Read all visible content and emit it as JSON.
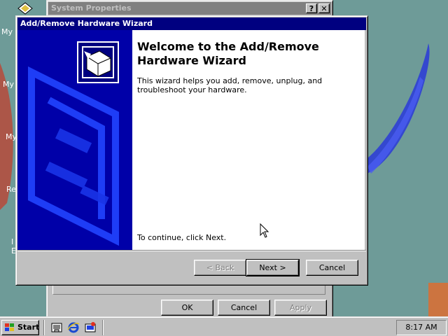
{
  "desktop": {
    "icon_labels": [
      "My D",
      "My",
      "My",
      "Re",
      "I",
      "E"
    ]
  },
  "system_properties": {
    "title": "System Properties",
    "help_glyph": "?",
    "close_glyph": "✕",
    "buttons": {
      "ok": "OK",
      "cancel": "Cancel",
      "apply": "Apply"
    }
  },
  "wizard": {
    "title": "Add/Remove Hardware Wizard",
    "heading": "Welcome to the Add/Remove Hardware Wizard",
    "body": "This wizard helps you add, remove, unplug, and troubleshoot your hardware.",
    "continue_text": "To continue, click Next.",
    "buttons": {
      "back": "< Back",
      "next": "Next >",
      "cancel": "Cancel"
    }
  },
  "taskbar": {
    "start_label": "Start",
    "quick_launch": [
      "show-desktop-icon",
      "internet-explorer-icon",
      "channels-icon"
    ],
    "clock": "8:17 AM"
  },
  "colors": {
    "desktop": "#6e9b98",
    "title_active": "#000080",
    "title_inactive": "#808080",
    "wizard_banner": "#0000a8",
    "wallpaper_accent": "#2a3ad8"
  }
}
